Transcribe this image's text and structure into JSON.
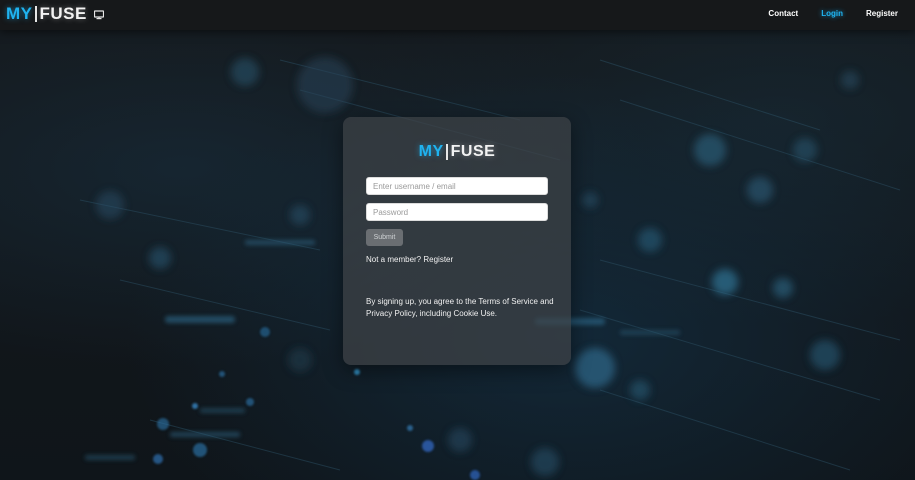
{
  "header": {
    "logo": {
      "my": "MY",
      "fuse": "FUSE"
    },
    "icon": "monitor-icon",
    "nav": {
      "contact": "Contact",
      "login": "Login",
      "register": "Register"
    },
    "active_item": "Login"
  },
  "card": {
    "logo": {
      "my": "MY",
      "fuse": "FUSE"
    },
    "username_placeholder": "Enter username / email",
    "password_placeholder": "Password",
    "submit_label": "Submit",
    "member_prefix": "Not a member?",
    "member_link": "Register",
    "terms": "By signing up, you agree to the Terms of Service and Privacy Policy, including Cookie Use."
  },
  "colors": {
    "accent": "#1fb3f0",
    "header_bg": "#16181a",
    "card_bg": "#3e4246"
  }
}
